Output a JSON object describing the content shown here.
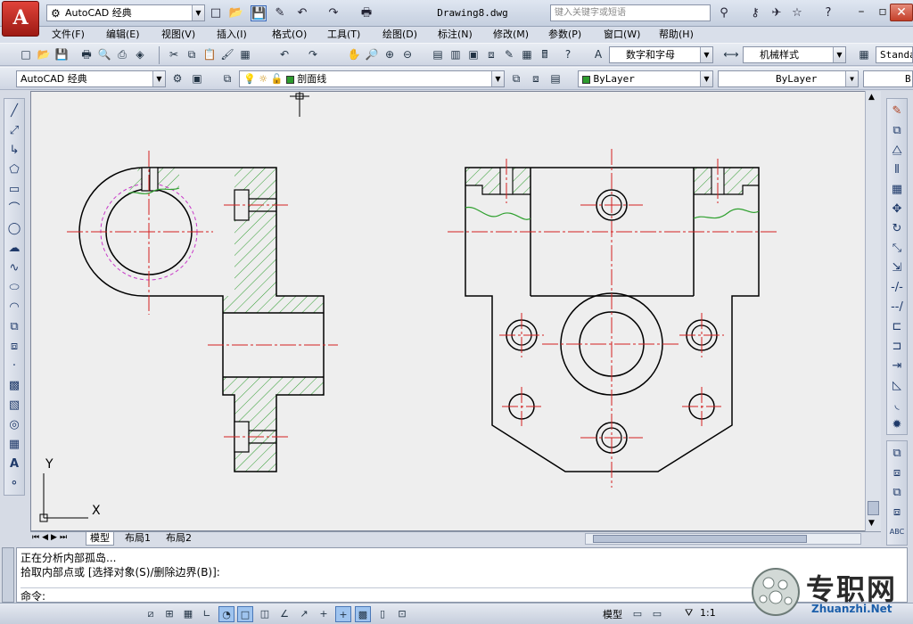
{
  "app": {
    "logo_letter": "A",
    "workspace": "AutoCAD 经典",
    "document_title": "Drawing8.dwg",
    "search_placeholder": "键入关键字或短语"
  },
  "menu": [
    "文件(F)",
    "编辑(E)",
    "视图(V)",
    "插入(I)",
    "格式(O)",
    "工具(T)",
    "绘图(D)",
    "标注(N)",
    "修改(M)",
    "参数(P)",
    "窗口(W)",
    "帮助(H)"
  ],
  "toolbar": {
    "text_style": "数字和字母",
    "dim_style": "机械样式",
    "table_style": "Standa",
    "workspace_combo": "AutoCAD 经典",
    "layer": "剖面线",
    "color": "ByLayer",
    "linetype": "ByLayer",
    "lineweight": "B"
  },
  "canvas": {
    "ucs_y": "Y",
    "ucs_x": "X"
  },
  "layout_tabs": [
    "模型",
    "布局1",
    "布局2"
  ],
  "command": {
    "line1": "正在分析内部孤岛...",
    "line2": "拾取内部点或 [选择对象(S)/删除边界(B)]:",
    "prompt": "命令:"
  },
  "status": {
    "model_label": "模型",
    "scale": "1:1"
  },
  "watermark": {
    "text": "专职网",
    "url": "Zhuanzhi.Net"
  },
  "colors": {
    "hatch": "#2e9c2e",
    "centerline": "#d42020",
    "break_line": "#2ea02e",
    "hidden_circle": "#c838c8",
    "accent": "#3a68b8"
  }
}
